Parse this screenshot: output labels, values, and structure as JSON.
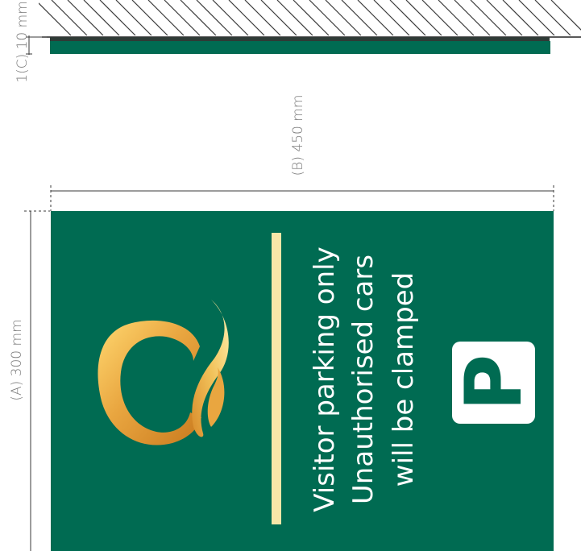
{
  "dimensions": {
    "height_label": "(A) 300 mm",
    "width_label": "(B) 450 mm",
    "depth_label": "1(C) 10 mm"
  },
  "sign": {
    "line1": "Visitor parking only",
    "line2": "Unauthorised cars",
    "line3": "will be clamped",
    "parking_letter": "P"
  },
  "colors": {
    "sign_green": "#006b52",
    "accent_cream": "#f7e6a8",
    "logo_gold": "#e9a640",
    "dimension_line": "#3a3a3a",
    "text_gray": "#7a7a7a"
  },
  "icons": {
    "logo": "gold-flame-ring-logo",
    "parking": "parking-sign-icon"
  }
}
